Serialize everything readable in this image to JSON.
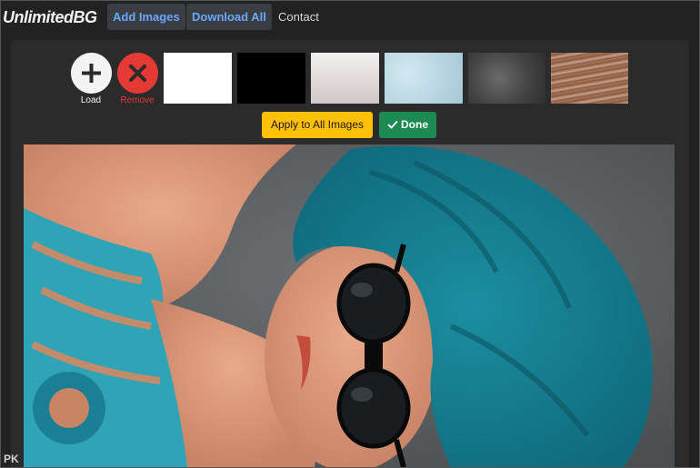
{
  "navbar": {
    "brand": "UnlimitedBG",
    "add_images": "Add Images",
    "download_all": "Download All",
    "contact": "Contact"
  },
  "toolbar": {
    "load_label": "Load",
    "remove_label": "Remove",
    "apply_label": "Apply to All Images",
    "done_label": "Done"
  },
  "backgrounds": [
    {
      "name": "white",
      "color": "#ffffff"
    },
    {
      "name": "black",
      "color": "#000000"
    },
    {
      "name": "light-gradient",
      "color": "#e0dcda"
    },
    {
      "name": "light-blue-texture",
      "color": "#bcd9e4"
    },
    {
      "name": "dark-concrete-texture",
      "color": "#4a4a4a"
    },
    {
      "name": "wood-texture",
      "color": "#9a6a4f"
    }
  ],
  "colors": {
    "accent_blue": "#6aa8ff",
    "apply_yellow": "#ffc107",
    "done_green": "#1e8a53",
    "remove_red": "#e53935"
  },
  "watermark": "PK"
}
